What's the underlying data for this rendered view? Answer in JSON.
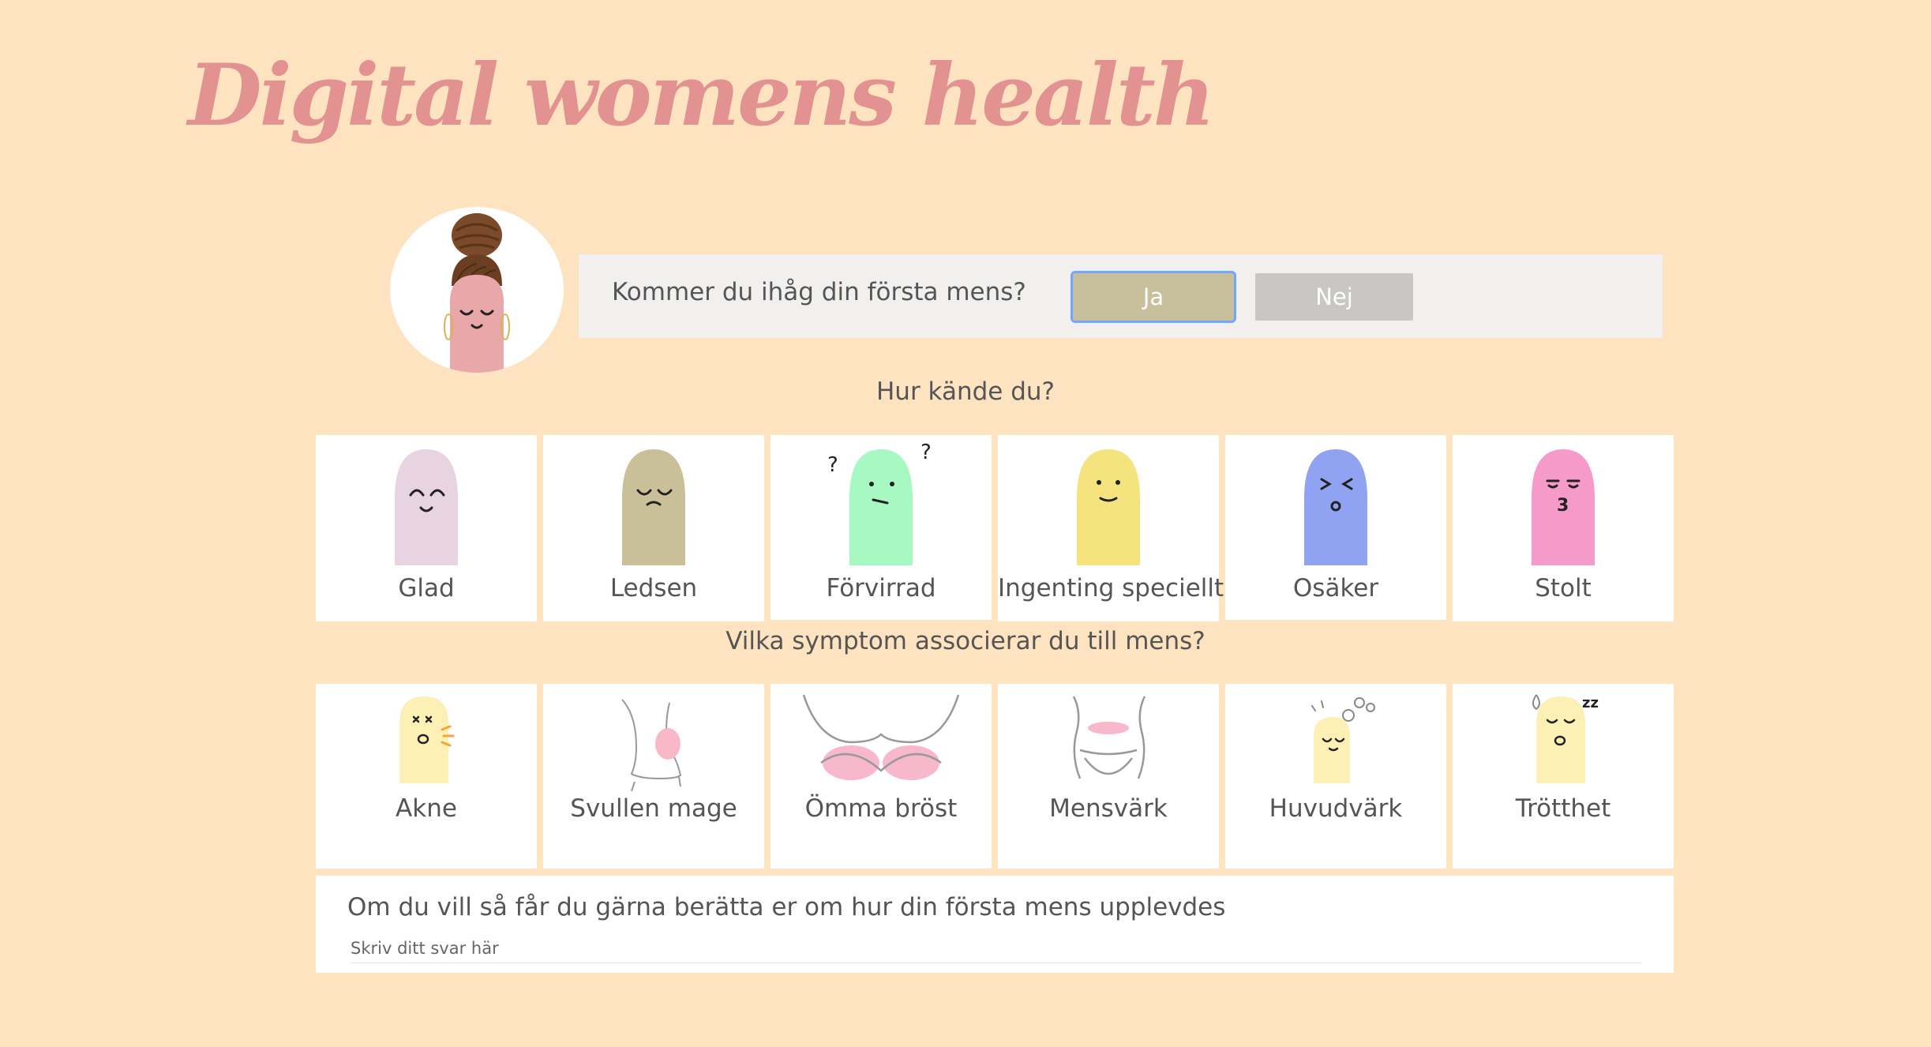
{
  "colors": {
    "background": "#fde3bf",
    "title": "#e39292",
    "yes_button": "#c8c09c",
    "no_button": "#c8c7c3"
  },
  "title": "Digital womens health",
  "question": {
    "text": "Kommer du ihåg din första mens?",
    "yes_label": "Ja",
    "no_label": "Nej",
    "selected": "Ja"
  },
  "feelings": {
    "heading": "Hur kände du?",
    "items": [
      {
        "label": "Glad",
        "icon": "happy-face-icon",
        "color": "#e8d3e2"
      },
      {
        "label": "Ledsen",
        "icon": "sad-face-icon",
        "color": "#c9c09a"
      },
      {
        "label": "Förvirrad",
        "icon": "confused-face-icon",
        "color": "#a8f8c4"
      },
      {
        "label": "Ingenting speciellt",
        "icon": "neutral-face-icon",
        "color": "#f5e47e"
      },
      {
        "label": "Osäker",
        "icon": "unsure-face-icon",
        "color": "#8fa3f2"
      },
      {
        "label": "Stolt",
        "icon": "proud-face-icon",
        "color": "#f69ac9"
      }
    ]
  },
  "symptoms": {
    "heading": "Vilka symptom associerar du till mens?",
    "items": [
      {
        "label": "Akne",
        "icon": "acne-icon"
      },
      {
        "label": "Svullen mage",
        "icon": "bloated-belly-icon"
      },
      {
        "label": "Ömma bröst",
        "icon": "tender-breasts-icon"
      },
      {
        "label": "Mensvärk",
        "icon": "cramps-icon"
      },
      {
        "label": "Huvudvärk",
        "icon": "headache-icon"
      },
      {
        "label": "Trötthet",
        "icon": "tiredness-icon"
      }
    ]
  },
  "note": {
    "label": "Om du vill så får du gärna berätta er om hur din första mens upplevdes",
    "placeholder": "Skriv ditt svar här"
  }
}
